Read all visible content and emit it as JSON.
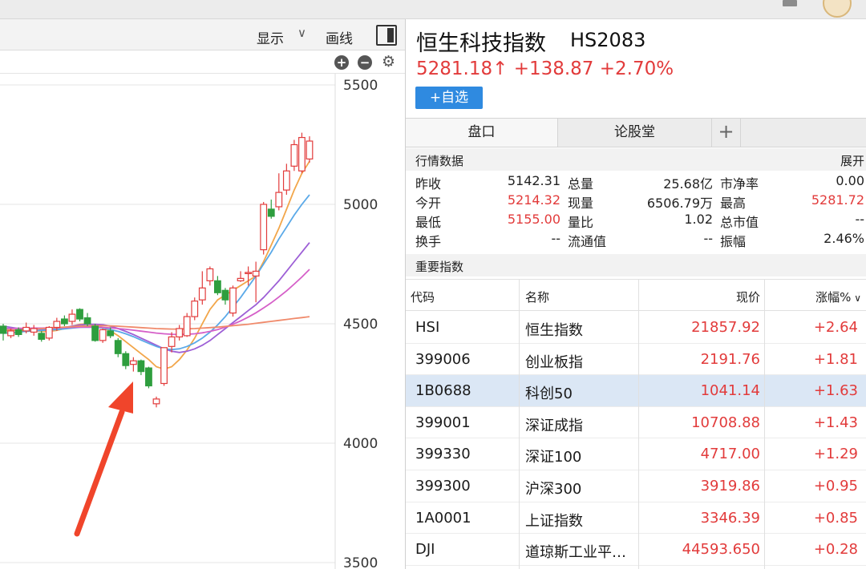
{
  "chart": {
    "toolbar": {
      "display_label": "显示",
      "display_chevron": "∨",
      "draw_label": "画线",
      "panel_icon": "panel-toggle-icon"
    },
    "controls": {
      "zoom_in": "+",
      "zoom_out": "−",
      "settings_icon": "gear-icon"
    },
    "y_axis_labels": [
      "5500",
      "5000",
      "4500",
      "4000",
      "3500"
    ]
  },
  "chart_data": {
    "type": "candlestick",
    "ylim": [
      3500,
      5500
    ],
    "y_ticks": [
      5500,
      5000,
      4500,
      4000,
      3500
    ],
    "grid": true,
    "up_color": "#e23b3b",
    "down_color": "#2e9e3e",
    "candles": [
      [
        4490,
        4460,
        4500,
        4430
      ],
      [
        4450,
        4470,
        4480,
        4440
      ],
      [
        4475,
        4455,
        4485,
        4445
      ],
      [
        4470,
        4485,
        4505,
        4460
      ],
      [
        4465,
        4480,
        4495,
        4450
      ],
      [
        4460,
        4435,
        4470,
        4425
      ],
      [
        4440,
        4485,
        4490,
        4430
      ],
      [
        4485,
        4510,
        4525,
        4470
      ],
      [
        4520,
        4500,
        4535,
        4490
      ],
      [
        4510,
        4540,
        4560,
        4495
      ],
      [
        4560,
        4520,
        4565,
        4510
      ],
      [
        4525,
        4500,
        4545,
        4490
      ],
      [
        4490,
        4430,
        4500,
        4425
      ],
      [
        4430,
        4475,
        4480,
        4420
      ],
      [
        4470,
        4450,
        4485,
        4440
      ],
      [
        4430,
        4375,
        4440,
        4360
      ],
      [
        4375,
        4325,
        4385,
        4310
      ],
      [
        4330,
        4345,
        4360,
        4300
      ],
      [
        4345,
        4300,
        4350,
        4285
      ],
      [
        4315,
        4240,
        4320,
        4230
      ],
      [
        4165,
        4185,
        4195,
        4150
      ],
      [
        4250,
        4400,
        4400,
        4240
      ],
      [
        4405,
        4445,
        4465,
        4380
      ],
      [
        4445,
        4480,
        4495,
        4430
      ],
      [
        4450,
        4530,
        4545,
        4445
      ],
      [
        4530,
        4595,
        4610,
        4515
      ],
      [
        4600,
        4650,
        4720,
        4580
      ],
      [
        4680,
        4730,
        4740,
        4660
      ],
      [
        4680,
        4630,
        4700,
        4620
      ],
      [
        4640,
        4600,
        4650,
        4580
      ],
      [
        4545,
        4650,
        4660,
        4530
      ],
      [
        4680,
        4690,
        4720,
        4675
      ],
      [
        4715,
        4715,
        4740,
        4660
      ],
      [
        4700,
        4720,
        4760,
        4590
      ],
      [
        4810,
        5000,
        5010,
        4790
      ],
      [
        4980,
        4950,
        5020,
        4940
      ],
      [
        4990,
        5050,
        5130,
        4975
      ],
      [
        5060,
        5140,
        5170,
        5040
      ],
      [
        5160,
        5250,
        5270,
        5140
      ],
      [
        5140,
        5280,
        5300,
        5130
      ],
      [
        5190,
        5265,
        5285,
        5175
      ]
    ],
    "ma_series": [
      {
        "color": "#f2a64a",
        "values": [
          4480,
          4475,
          4472,
          4470,
          4470,
          4468,
          4468,
          4472,
          4480,
          4490,
          4498,
          4500,
          4495,
          4485,
          4470,
          4450,
          4425,
          4400,
          4375,
          4350,
          4320,
          4310,
          4320,
          4350,
          4390,
          4440,
          4500,
          4560,
          4600,
          4620,
          4640,
          4660,
          4680,
          4700,
          4760,
          4830,
          4900,
          4980,
          5060,
          5130,
          5180
        ]
      },
      {
        "color": "#9d5fd6",
        "values": [
          4490,
          4485,
          4480,
          4478,
          4478,
          4478,
          4478,
          4480,
          4485,
          4490,
          4495,
          4498,
          4498,
          4496,
          4490,
          4480,
          4468,
          4455,
          4440,
          4425,
          4410,
          4395,
          4385,
          4380,
          4385,
          4395,
          4410,
          4430,
          4455,
          4480,
          4505,
          4530,
          4555,
          4580,
          4610,
          4645,
          4680,
          4720,
          4760,
          4800,
          4840
        ]
      },
      {
        "color": "#5aa9e8",
        "values": [
          4460,
          4462,
          4465,
          4468,
          4470,
          4472,
          4474,
          4476,
          4479,
          4482,
          4485,
          4486,
          4485,
          4482,
          4476,
          4468,
          4458,
          4446,
          4432,
          4418,
          4405,
          4395,
          4392,
          4395,
          4405,
          4420,
          4440,
          4465,
          4495,
          4530,
          4570,
          4610,
          4655,
          4700,
          4750,
          4800,
          4855,
          4905,
          4955,
          5000,
          5040
        ]
      },
      {
        "color": "#d55fc8",
        "values": [
          4480,
          4480,
          4481,
          4481,
          4482,
          4482,
          4483,
          4483,
          4484,
          4485,
          4486,
          4486,
          4486,
          4485,
          4483,
          4480,
          4477,
          4473,
          4469,
          4465,
          4461,
          4458,
          4456,
          4455,
          4456,
          4458,
          4462,
          4468,
          4476,
          4486,
          4498,
          4512,
          4528,
          4546,
          4566,
          4588,
          4612,
          4638,
          4666,
          4696,
          4728
        ]
      },
      {
        "color": "#f08a6b",
        "values": [
          4470,
          4472,
          4474,
          4476,
          4478,
          4480,
          4482,
          4484,
          4486,
          4488,
          4490,
          4491,
          4492,
          4492,
          4491,
          4490,
          4488,
          4486,
          4484,
          4482,
          4480,
          4479,
          4478,
          4478,
          4479,
          4480,
          4482,
          4484,
          4486,
          4489,
          4492,
          4495,
          4498,
          4502,
          4506,
          4510,
          4514,
          4518,
          4522,
          4526,
          4530
        ]
      }
    ]
  },
  "quote": {
    "name": "恒生科技指数",
    "code": "HS2083",
    "price_line": "5281.18↑ +138.87 +2.70%",
    "add_watch": "+自选"
  },
  "tabs": [
    {
      "label": "盘口"
    },
    {
      "label": "论股堂"
    }
  ],
  "tab_plus": "+",
  "market_section": {
    "title": "行情数据",
    "expand": "展开"
  },
  "stats": {
    "rows": [
      [
        {
          "label": "昨收",
          "value": "5142.31",
          "red": false
        },
        {
          "label": "总量",
          "value": "25.68亿",
          "red": false
        },
        {
          "label": "市净率",
          "value": "0.00",
          "red": false
        }
      ],
      [
        {
          "label": "今开",
          "value": "5214.32",
          "red": true
        },
        {
          "label": "现量",
          "value": "6506.79万",
          "red": false
        },
        {
          "label": "最高",
          "value": "5281.72",
          "red": true
        }
      ],
      [
        {
          "label": "最低",
          "value": "5155.00",
          "red": true
        },
        {
          "label": "量比",
          "value": "1.02",
          "red": false
        },
        {
          "label": "总市值",
          "value": "--",
          "red": false
        }
      ],
      [
        {
          "label": "换手",
          "value": "--",
          "red": false
        },
        {
          "label": "流通值",
          "value": "--",
          "red": false
        },
        {
          "label": "振幅",
          "value": "2.46%",
          "red": false
        }
      ]
    ]
  },
  "index_section": {
    "title": "重要指数"
  },
  "index_table": {
    "headers": {
      "code": "代码",
      "name": "名称",
      "price": "现价",
      "change": "涨幅%"
    },
    "rows": [
      {
        "code": "HSI",
        "name": "恒生指数",
        "price": "21857.92",
        "change": "+2.64"
      },
      {
        "code": "399006",
        "name": "创业板指",
        "price": "2191.76",
        "change": "+1.81"
      },
      {
        "code": "1B0688",
        "name": "科创50",
        "price": "1041.14",
        "change": "+1.63"
      },
      {
        "code": "399001",
        "name": "深证成指",
        "price": "10708.88",
        "change": "+1.43"
      },
      {
        "code": "399330",
        "name": "深证100",
        "price": "4717.00",
        "change": "+1.29"
      },
      {
        "code": "399300",
        "name": "沪深300",
        "price": "3919.86",
        "change": "+0.95"
      },
      {
        "code": "1A0001",
        "name": "上证指数",
        "price": "3346.39",
        "change": "+0.85"
      },
      {
        "code": "DJI",
        "name": "道琼斯工业平…",
        "price": "44593.650",
        "change": "+0.28"
      }
    ],
    "selected_row": 2
  }
}
